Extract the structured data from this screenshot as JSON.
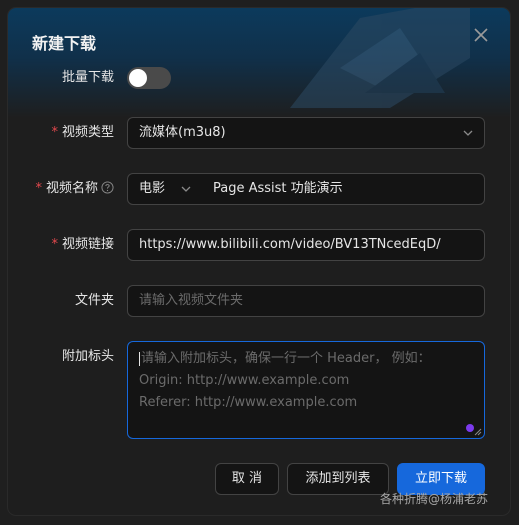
{
  "dialog": {
    "title": "新建下载",
    "close_icon": "close-icon"
  },
  "batch": {
    "label": "批量下载",
    "enabled": false
  },
  "video_type": {
    "label": "视频类型",
    "required_mark": "*",
    "value": "流媒体(m3u8)"
  },
  "video_name": {
    "label": "视频名称",
    "required_mark": "*",
    "help_icon": "question-circle-icon",
    "category_value": "电影",
    "value": "Page Assist 功能演示"
  },
  "video_link": {
    "label": "视频链接",
    "required_mark": "*",
    "value": "https://www.bilibili.com/video/BV13TNcedEqD/"
  },
  "folder": {
    "label": "文件夹",
    "placeholder": "请输入视频文件夹"
  },
  "headers": {
    "label": "附加标头",
    "placeholder_lines": [
      "请输入附加标头，确保一行一个 Header， 例如：",
      "Origin: http://www.example.com",
      "Referer: http://www.example.com"
    ]
  },
  "buttons": {
    "cancel": "取 消",
    "add_to_list": "添加到列表",
    "download_now": "立即下载"
  },
  "watermark": "各种折腾@杨浦老苏",
  "colors": {
    "primary": "#1668dc",
    "required": "#e5484d",
    "background": "#1e1e1e"
  }
}
